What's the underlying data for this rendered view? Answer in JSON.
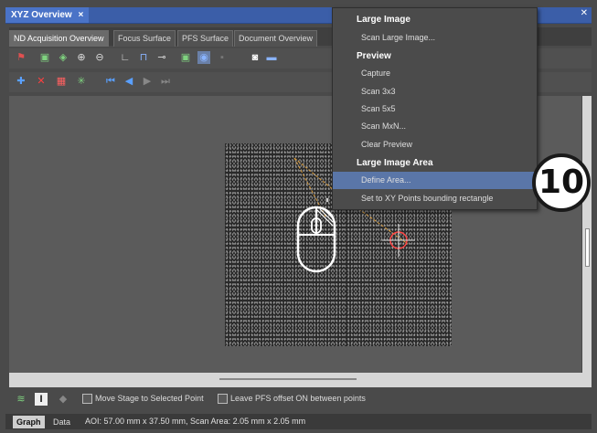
{
  "window": {
    "title": "XYZ Overview",
    "close": "×"
  },
  "tabs": [
    "ND Acquisition Overview",
    "Focus Surface",
    "PFS Surface",
    "Document Overview"
  ],
  "context_menu": {
    "sections": [
      {
        "header": "Large Image",
        "items": [
          "Scan Large Image..."
        ]
      },
      {
        "header": "Preview",
        "items": [
          "Capture",
          "Scan 3x3",
          "Scan 5x5",
          "Scan MxN...",
          "Clear Preview"
        ]
      },
      {
        "header": "Large Image Area",
        "items": [
          "Define Area...",
          "Set to XY Points bounding rectangle"
        ]
      }
    ],
    "selected": "Define Area..."
  },
  "options": {
    "move_stage": "Move Stage to Selected Point",
    "leave_pfs": "Leave PFS offset ON between points"
  },
  "status": {
    "tabs": [
      "Graph",
      "Data"
    ],
    "text": "AOI: 57.00 mm x 37.50 mm, Scan Area: 2.05 mm x 2.05 mm"
  },
  "step_badge": "10",
  "colors": {
    "accent": "#4a73c7",
    "selection": "#5a76a8",
    "panel": "#4a4a4a"
  }
}
